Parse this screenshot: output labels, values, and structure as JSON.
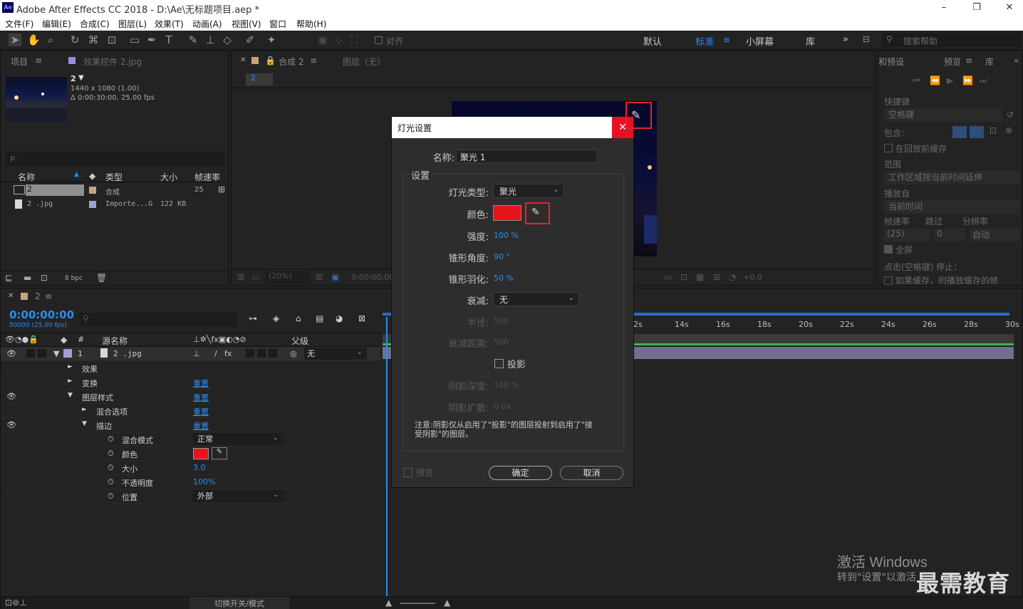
{
  "app": {
    "icon": "Ae",
    "title": "Adobe After Effects CC 2018 - D:\\Ae\\无标题项目.aep *",
    "min": "–",
    "max": "❐",
    "close": "✕"
  },
  "menu": [
    "文件(F)",
    "编辑(E)",
    "合成(C)",
    "图层(L)",
    "效果(T)",
    "动画(A)",
    "视图(V)",
    "窗口",
    "帮助(H)"
  ],
  "toolbar": {
    "align": "对齐",
    "workspaces": [
      "默认",
      "标准",
      "小屏幕",
      "库"
    ],
    "active_ws": "标准",
    "more": "»",
    "search_placeholder": "搜索帮助"
  },
  "project": {
    "tab_project": "项目",
    "tab_effect": "效果控件 2.jpg",
    "comp_name": "2",
    "comp_info1": "1440 x 1080 (1.00)",
    "comp_info2": "Δ 0:00:30:00, 25.00 fps",
    "search": "ρ.",
    "headers": [
      "名称",
      "类型",
      "大小",
      "帧速率"
    ],
    "items": [
      {
        "name": "2",
        "type": "合成",
        "size": "",
        "fps": "25"
      },
      {
        "name": "2 .jpg",
        "type": "Importe...G",
        "size": "122 KB",
        "fps": ""
      }
    ],
    "bpc": "8 bpc"
  },
  "comp": {
    "tab": "合成 2",
    "layer_tab": "图层（无）",
    "name_chip": "2",
    "zoom": "(20%)",
    "time": "0:00:00:00",
    "exposure": "+0.0"
  },
  "right": {
    "preview_tab": "预览",
    "info_tab": "和预设",
    "lib_tab": "库",
    "shortcut_label": "快捷键",
    "shortcut_val": "空格键",
    "include": "包含:",
    "cache": "在回放前缓存",
    "range": "范围",
    "range_val": "工作区域按当前时间延伸",
    "play_from": "播放自",
    "play_val": "当前时间",
    "fps": "帧速率",
    "skip": "跳过",
    "res": "分辨率",
    "fps_val": "(25)",
    "skip_val": "0",
    "res_val": "自动",
    "full": "全屏",
    "stop": "点击(空格键) 停止：",
    "if_cache": "如果缓存，则播放缓存的帧"
  },
  "timeline": {
    "tab": "2",
    "time": "0:00:00:00",
    "frame": "00000 (25.00 fps)",
    "col_source": "源名称",
    "col_parent": "父级",
    "layer_num": "1",
    "layer_name": "2 .jpg",
    "parent_val": "无",
    "rows": [
      {
        "label": "效果",
        "indent": 1,
        "arrow": "►",
        "val": ""
      },
      {
        "label": "变换",
        "indent": 1,
        "arrow": "►",
        "val": "重置"
      },
      {
        "label": "图层样式",
        "indent": 1,
        "arrow": "▼",
        "val": "重置"
      },
      {
        "label": "混合选项",
        "indent": 2,
        "arrow": "►",
        "val": "重置"
      },
      {
        "label": "描边",
        "indent": 2,
        "arrow": "▼",
        "val": "重置"
      }
    ],
    "props": [
      {
        "label": "混合模式",
        "val": "正常",
        "kind": "select"
      },
      {
        "label": "颜色",
        "val": "",
        "kind": "color"
      },
      {
        "label": "大小",
        "val": "3.0",
        "kind": "num"
      },
      {
        "label": "不透明度",
        "val": "100%",
        "kind": "num"
      },
      {
        "label": "位置",
        "val": "外部",
        "kind": "select"
      }
    ],
    "ticks": [
      "2s",
      "14s",
      "16s",
      "18s",
      "20s",
      "22s",
      "24s",
      "26s",
      "28s",
      "30s"
    ],
    "footer": "切换开关/模式"
  },
  "dialog": {
    "title": "灯光设置",
    "close": "✕",
    "name_label": "名称:",
    "name_val": "聚光 1",
    "group": "设置",
    "type_label": "灯光类型:",
    "type_val": "聚光",
    "color_label": "颜色:",
    "intensity_label": "强度:",
    "intensity_val": "100 %",
    "cone_label": "锥形角度:",
    "cone_val": "90 °",
    "feather_label": "锥形羽化:",
    "feather_val": "50 %",
    "falloff_label": "衰减:",
    "falloff_val": "无",
    "radius_label": "半径:",
    "radius_val": "500",
    "dist_label": "衰减距离:",
    "dist_val": "500",
    "shadow_label": "投影",
    "depth_label": "阴影深度:",
    "depth_val": "100 %",
    "spread_label": "阴影扩散:",
    "spread_val": "0 px",
    "note": "注意:阴影仅从启用了\"投影\"的图层投射到启用了\"接受阴影\"的图层。",
    "preview": "预览",
    "ok": "确定",
    "cancel": "取消"
  },
  "watermark": {
    "line1": "激活 Windows",
    "line2": "转到\"设置\"以激活",
    "logo": "最需教育"
  },
  "colors": {
    "light": "#e8141c",
    "accent": "#2d8ceb"
  }
}
